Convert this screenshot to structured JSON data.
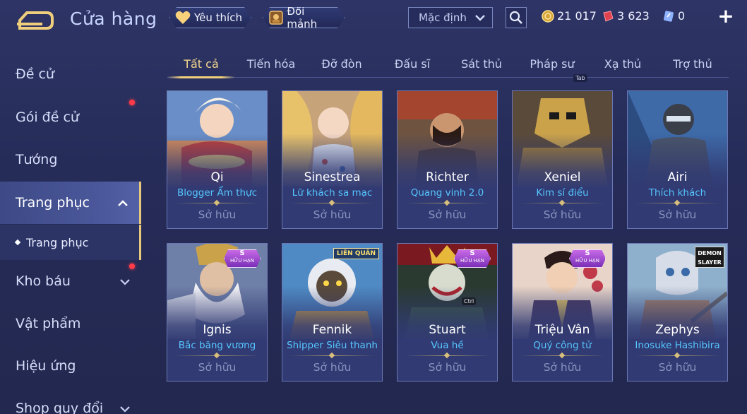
{
  "header": {
    "title": "Cửa hàng",
    "favorites_label": "Yêu thích",
    "fragments_label": "Đổi mảnh",
    "sort_value": "Mặc định",
    "gold": "21 017",
    "gems": "3 623",
    "tickets": "0"
  },
  "sidebar": {
    "items": [
      {
        "label": "Đề cử"
      },
      {
        "label": "Gói đề cử"
      },
      {
        "label": "Tướng"
      },
      {
        "label": "Trang phục"
      },
      {
        "label": "Kho báu"
      },
      {
        "label": "Vật phẩm"
      },
      {
        "label": "Hiệu ứng"
      },
      {
        "label": "Shop quy đổi"
      }
    ],
    "sub_item": "Trang phục"
  },
  "tabs": [
    "Tất cả",
    "Tiến hóa",
    "Đỡ đòn",
    "Đấu sĩ",
    "Sát thủ",
    "Pháp sư",
    "Xạ thủ",
    "Trợ thủ"
  ],
  "tab_hint": "Tab",
  "ctrl_hint": "Ctrl",
  "cards": [
    {
      "hero": "Qi",
      "skin": "Blogger Ẩm thực",
      "status": "Sở hữu"
    },
    {
      "hero": "Sinestrea",
      "skin": "Lữ khách sa mạc",
      "status": "Sở hữu"
    },
    {
      "hero": "Richter",
      "skin": "Quang vinh 2.0",
      "status": "Sở hữu"
    },
    {
      "hero": "Xeniel",
      "skin": "Kim sí điểu",
      "status": "Sở hữu"
    },
    {
      "hero": "Airi",
      "skin": "Thích khách",
      "status": "Sở hữu"
    },
    {
      "hero": "Ignis",
      "skin": "Bắc băng vương",
      "status": "Sở hữu",
      "badge": "S",
      "badge_sub": "HỮU HẠN"
    },
    {
      "hero": "Fennik",
      "skin": "Shipper Siêu thanh",
      "status": "Sở hữu",
      "logo": "LIÊN QUÂN"
    },
    {
      "hero": "Stuart",
      "skin": "Vua hề",
      "status": "Sở hữu",
      "badge": "S",
      "badge_sub": "HỮU HẠN"
    },
    {
      "hero": "Triệu Vân",
      "skin": "Quý công tử",
      "status": "Sở hữu",
      "badge": "S",
      "badge_sub": "HỮU HẠN"
    },
    {
      "hero": "Zephys",
      "skin": "Inosuke Hashibira",
      "status": "Sở hữu",
      "logo": "DEMON SLAYER"
    }
  ]
}
